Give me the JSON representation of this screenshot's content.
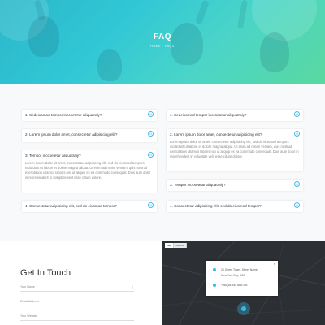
{
  "hero": {
    "title": "FAQ",
    "breadcrumb": "HOME · FAQS"
  },
  "faq": {
    "left": [
      {
        "question": "1. Sedeiusmod tempor inccsetetur aliquatraiy?",
        "toggle": "⊖",
        "open": false
      },
      {
        "question": "2. Lorem ipsum dolor amet, consectetur adipisicing elit?",
        "toggle": "⊖",
        "open": false
      },
      {
        "question": "3. Tempor inccsetetur aliquatraiy?",
        "toggle": "⊖",
        "open": true,
        "answer": "Lorem ipsum dolor sit amet, consectetur adipisicing elit, sed do eiusmod tempors incididunt ut labore et dolore magna aliqua. Ut enim ad minim veniam, quis nostrud exercitation ullamco laboris nisi ut aliquip ex ea commodo consequat. Duis aute dolor in reprehenderit in voluptate velit esse cillum dolore."
      },
      {
        "question": "4. Consectetur adipisicing elit, sed do eiusmod tempor?",
        "toggle": "⊖",
        "open": false
      }
    ],
    "right": [
      {
        "question": "1. Sedeiusmod tempor inccsetetur aliquatraiy?",
        "toggle": "⊖",
        "open": false
      },
      {
        "question": "2. Lorem ipsum dolor amet, consectetur adipisicing elit?",
        "toggle": "⊖",
        "open": true,
        "answer": "Lorem ipsum dolor sit amet, consectetur adipisicing elit, sed do eiusmod tempors incididunt ut labore et dolore magna aliqua. Ut enim ad minim veniam, quis nostrud exercitation ullamco laboris nisi ut aliquip ex ea commodo consequat. Duis aute dolor in reprehenderit in voluptate velit esse cillum dolore."
      },
      {
        "question": "3. Tempor inccsetetur aliquatraiy?",
        "toggle": "⊖",
        "open": false
      },
      {
        "question": "4. Consectetur adipisicing elit, sed do eiusmod tempor?",
        "toggle": "⊖",
        "open": false
      }
    ]
  },
  "contact": {
    "title": "Get In Touch",
    "name_placeholder": "Your Name",
    "email_placeholder": "Email Address",
    "website_placeholder": "Your Website",
    "name_icon": "user-icon"
  },
  "map": {
    "tab_map": "Map",
    "tab_satellite": "Satellite",
    "popup_address_line1": "26 Green Tower, Street Name",
    "popup_address_line2": "New York City, USA",
    "popup_phone": "+880(54 545 888 026",
    "popup_close": "×",
    "accent": "#39b9e6"
  }
}
